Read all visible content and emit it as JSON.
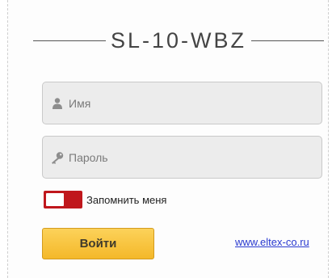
{
  "login": {
    "title": "SL-10-WBZ",
    "username": {
      "placeholder": "Имя",
      "value": "",
      "icon": "user-icon"
    },
    "password": {
      "placeholder": "Пароль",
      "value": "",
      "icon": "key-icon"
    },
    "remember": {
      "label": "Запомнить меня",
      "checked": false,
      "accent_color": "#c0171c"
    },
    "submit_label": "Войти",
    "link_text": "www.eltex-co.ru",
    "button_color": "#f4b829"
  }
}
